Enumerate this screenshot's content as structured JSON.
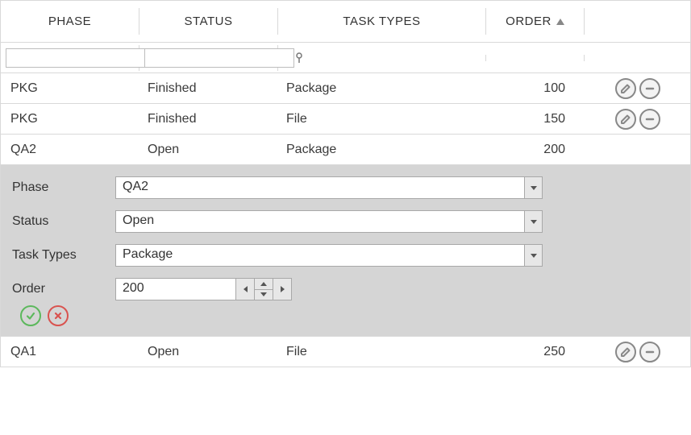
{
  "columns": {
    "phase": "PHASE",
    "status": "STATUS",
    "task_types": "TASK TYPES",
    "order": "ORDER"
  },
  "sort": {
    "column": "order",
    "direction": "asc"
  },
  "filters": {
    "phase": "",
    "status": ""
  },
  "rows": [
    {
      "phase": "PKG",
      "status": "Finished",
      "task_types": "Package",
      "order": 100,
      "actions": true,
      "editing": false
    },
    {
      "phase": "PKG",
      "status": "Finished",
      "task_types": "File",
      "order": 150,
      "actions": true,
      "editing": false
    },
    {
      "phase": "QA2",
      "status": "Open",
      "task_types": "Package",
      "order": 200,
      "actions": false,
      "editing": true
    },
    {
      "phase": "QA1",
      "status": "Open",
      "task_types": "File",
      "order": 250,
      "actions": true,
      "editing": false
    }
  ],
  "edit_form": {
    "labels": {
      "phase": "Phase",
      "status": "Status",
      "task_types": "Task Types",
      "order": "Order"
    },
    "values": {
      "phase": "QA2",
      "status": "Open",
      "task_types": "Package",
      "order": "200"
    }
  }
}
